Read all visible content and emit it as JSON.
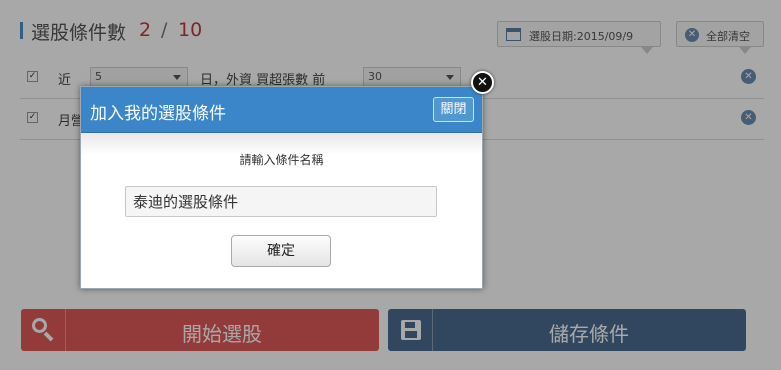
{
  "header": {
    "title": "選股條件數",
    "count_current": "2",
    "count_separator": "/",
    "count_max": "10",
    "date_label": "選股日期:2015/09/9",
    "clear_label": "全部清空"
  },
  "conditions": [
    {
      "checked": true,
      "prefix": "近",
      "days_value": "5",
      "text": "日，外資 買超張數 前",
      "rank_value": "30"
    },
    {
      "checked": true,
      "prefix": "月營"
    }
  ],
  "buttons": {
    "start_label": "開始選股",
    "save_label": "儲存條件"
  },
  "modal": {
    "title": "加入我的選股條件",
    "close_label": "關閉",
    "prompt": "請輸入條件名稱",
    "input_value": "泰迪的選股條件",
    "confirm_label": "確定"
  },
  "colors": {
    "accent_blue": "#3a86c8",
    "count_red": "#c03b3b",
    "start_red": "#e05858",
    "save_blue": "#4a6d90"
  },
  "icons": [
    "calendar-icon",
    "clear-icon",
    "checkbox-icon",
    "delete-icon",
    "search-icon",
    "save-disk-icon",
    "close-x-icon"
  ]
}
